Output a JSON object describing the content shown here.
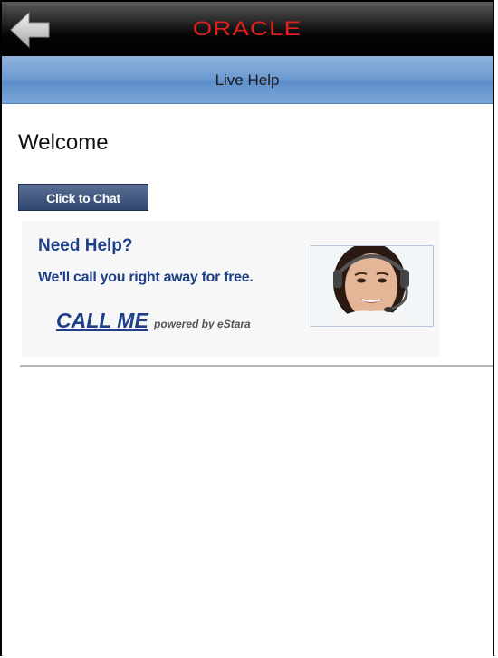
{
  "header": {
    "logo_text": "ORACLE",
    "back_icon": "back-arrow-icon",
    "logo_color": "#e0201b"
  },
  "titlebar": {
    "title": "Live Help"
  },
  "main": {
    "welcome": "Welcome",
    "chat_button_label": "Click to Chat",
    "help_box": {
      "title": "Need Help?",
      "subtitle": "We'll call you right away for free.",
      "call_me_label": "CALL ME",
      "powered_by": "powered by eStara",
      "agent_image": "support-agent-headset-photo"
    }
  },
  "colors": {
    "title_bar_blue": "#6f9dd2",
    "help_text_blue": "#1f3f86",
    "chat_button": "#2f4670"
  }
}
